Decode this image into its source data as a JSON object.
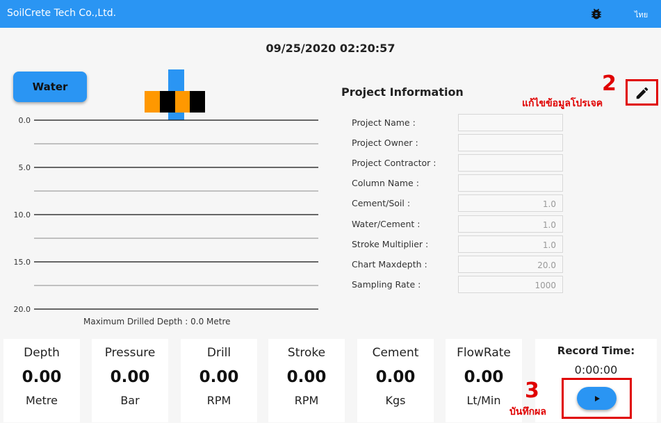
{
  "appbar": {
    "title": "SoilCrete Tech Co.,Ltd.",
    "lang": "ไทย",
    "debug_icon": "bug-icon"
  },
  "datetime": "09/25/2020 02:20:57",
  "water_button": "Water",
  "chart": {
    "y_ticks": [
      "0.0",
      "5.0",
      "10.0",
      "15.0",
      "20.0"
    ],
    "caption": "Maximum Drilled Depth : 0.0 Metre"
  },
  "chart_data": {
    "type": "line",
    "title": "",
    "xlabel": "",
    "ylabel": "",
    "ylim": [
      0,
      20
    ],
    "y_ticks": [
      0,
      5,
      10,
      15,
      20
    ],
    "y_inverted": true,
    "grid": true,
    "max_drilled_depth": 0.0,
    "series": []
  },
  "project": {
    "title": "Project Information",
    "fields": [
      {
        "label": "Project Name :",
        "value": ""
      },
      {
        "label": "Project Owner :",
        "value": ""
      },
      {
        "label": "Project Contractor :",
        "value": ""
      },
      {
        "label": "Column Name :",
        "value": ""
      },
      {
        "label": "Cement/Soil :",
        "value": "1.0"
      },
      {
        "label": "Water/Cement :",
        "value": "1.0"
      },
      {
        "label": "Stroke Multiplier :",
        "value": "1.0"
      },
      {
        "label": "Chart Maxdepth :",
        "value": "20.0"
      },
      {
        "label": "Sampling Rate :",
        "value": "1000"
      }
    ],
    "edit_icon": "pencil-icon"
  },
  "annotations": {
    "edit_number": "2",
    "edit_text": "แก้ไขข้อมูลโปรเจค",
    "record_number": "3",
    "record_text": "บันทึกผล"
  },
  "metrics": [
    {
      "name": "Depth",
      "value": "0.00",
      "unit": "Metre"
    },
    {
      "name": "Pressure",
      "value": "0.00",
      "unit": "Bar"
    },
    {
      "name": "Drill",
      "value": "0.00",
      "unit": "RPM"
    },
    {
      "name": "Stroke",
      "value": "0.00",
      "unit": "RPM"
    },
    {
      "name": "Cement",
      "value": "0.00",
      "unit": "Kgs"
    },
    {
      "name": "FlowRate",
      "value": "0.00",
      "unit": "Lt/Min"
    }
  ],
  "record": {
    "label": "Record Time:",
    "time": "0:00:00",
    "play_icon": "play-icon"
  },
  "colors": {
    "accent": "#2a95f3",
    "annotation": "#e00000",
    "orange": "#ff9800",
    "black": "#000000"
  }
}
